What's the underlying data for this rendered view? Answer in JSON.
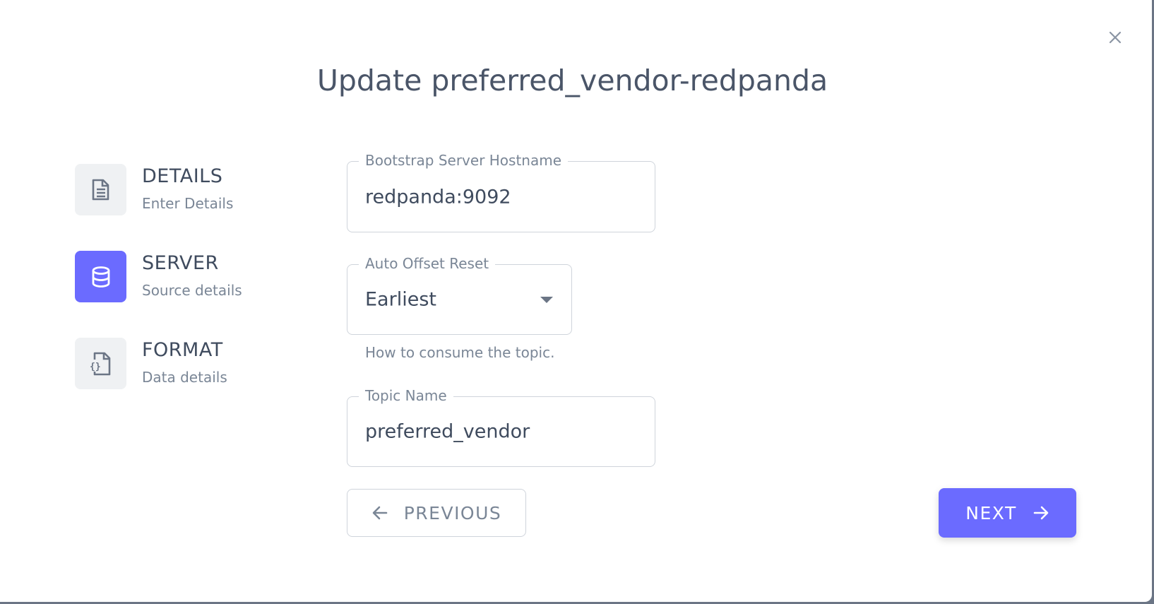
{
  "dialog": {
    "title": "Update preferred_vendor-redpanda",
    "close_icon": "close-icon"
  },
  "steps": [
    {
      "title": "DETAILS",
      "subtitle": "Enter Details",
      "icon": "document-icon",
      "active": false
    },
    {
      "title": "SERVER",
      "subtitle": "Source details",
      "icon": "database-icon",
      "active": true
    },
    {
      "title": "FORMAT",
      "subtitle": "Data details",
      "icon": "code-file-icon",
      "active": false
    }
  ],
  "form": {
    "bootstrap": {
      "label": "Bootstrap Server Hostname",
      "value": "redpanda:9092"
    },
    "offset": {
      "label": "Auto Offset Reset",
      "value": "Earliest",
      "helper": "How to consume the topic."
    },
    "topic": {
      "label": "Topic Name",
      "value": "preferred_vendor"
    }
  },
  "buttons": {
    "previous": "PREVIOUS",
    "next": "NEXT"
  },
  "colors": {
    "accent": "#6b6bff",
    "text": "#3f4b5e",
    "muted": "#7a8696"
  }
}
